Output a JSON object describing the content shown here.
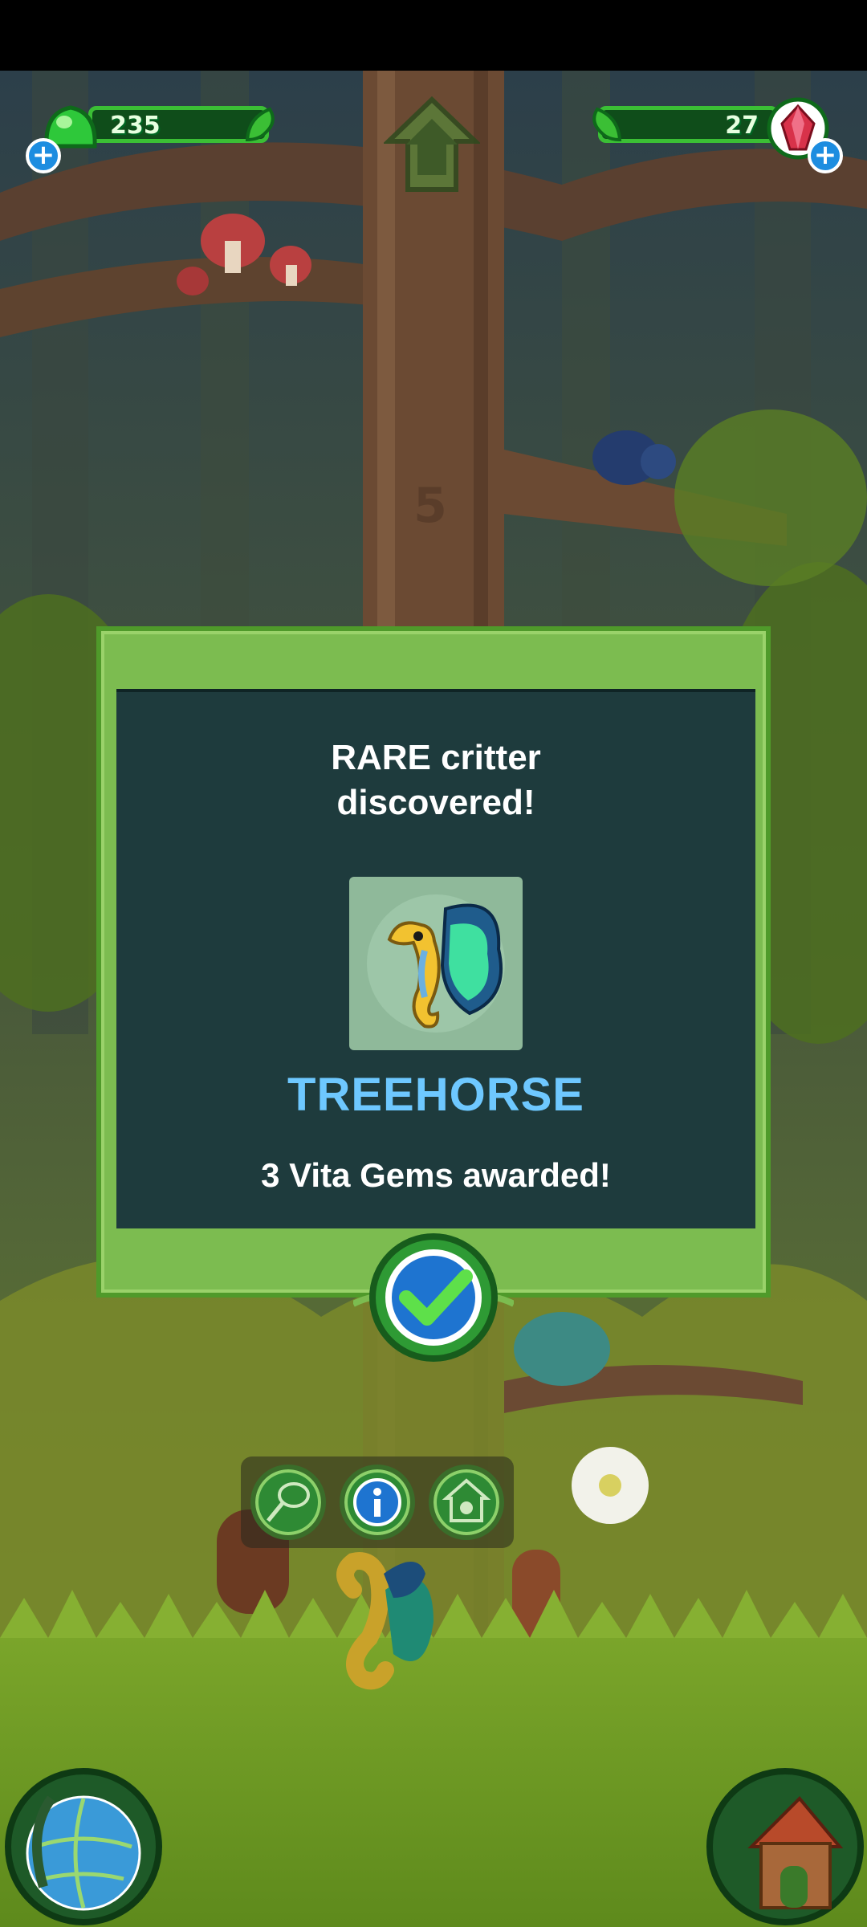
{
  "hud": {
    "slime_count": "235",
    "gem_count": "27"
  },
  "dialog": {
    "title_line1": "RARE critter",
    "title_line2": "discovered!",
    "critter_name": "TREEHORSE",
    "award_text": "3 Vita Gems awarded!"
  },
  "scene": {
    "tree_floor_number": "5"
  },
  "icons": {
    "slime": "green-slime-icon",
    "gem": "red-gem-icon",
    "home": "home-arrow-icon",
    "confirm": "checkmark-icon",
    "net": "net-icon",
    "info": "info-icon",
    "habitat": "habitat-icon",
    "globe": "globe-icon",
    "house": "house-icon"
  },
  "colors": {
    "dialog_bg": "#1e3b3d",
    "dialog_border": "#7cbc50",
    "critter_name": "#6ec8ff",
    "hud_border": "#3bbf35"
  }
}
